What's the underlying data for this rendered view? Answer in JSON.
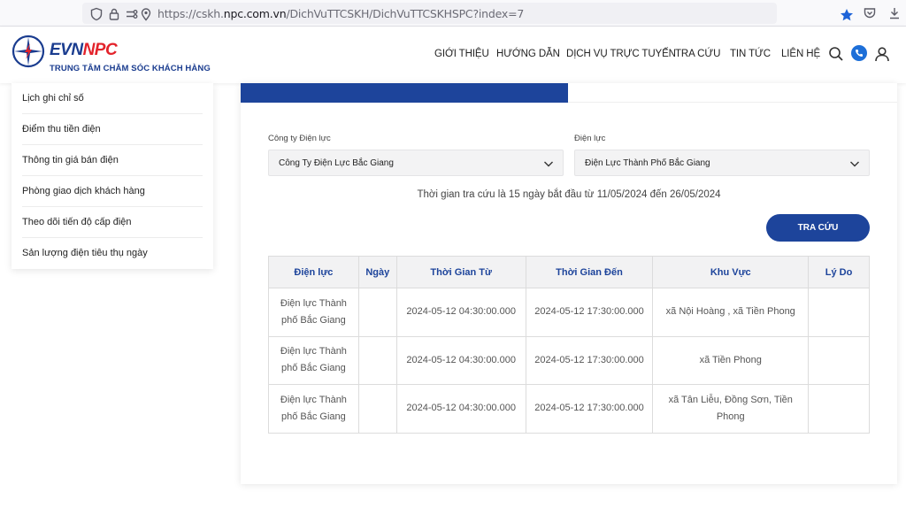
{
  "browser": {
    "url_prefix": "https://cskh.",
    "url_domain": "npc.com.vn",
    "url_path": "/DichVuTTCSKH/DichVuTTCSKHSPC?index=7"
  },
  "header": {
    "brand_evn": "EVN",
    "brand_npc": "NPC",
    "tagline": "TRUNG TÂM CHĂM SÓC KHÁCH HÀNG",
    "nav": [
      "GIỚI THIỆU",
      "HƯỚNG DẪN",
      "DỊCH VỤ TRỰC TUYẾN",
      "TRA CỨU",
      "TIN TỨC",
      "LIÊN HỆ"
    ]
  },
  "sidebar": {
    "items": [
      "Lịch ghi chỉ số",
      "Điểm thu tiền điện",
      "Thông tin giá bán điện",
      "Phòng giao dịch khách hàng",
      "Theo dõi tiến độ cấp điện",
      "Sản lượng điện tiêu thụ ngày"
    ]
  },
  "form": {
    "company_label": "Công ty Điện lực",
    "company_value": "Công Ty Điện Lực Bắc Giang",
    "branch_label": "Điện lực",
    "branch_value": "Điện Lực Thành Phố Bắc Giang",
    "info": "Thời gian tra cứu là 15 ngày bắt đầu từ 11/05/2024 đến 26/05/2024",
    "search_button": "TRA CỨU"
  },
  "table": {
    "headers": [
      "Điện lực",
      "Ngày",
      "Thời Gian Từ",
      "Thời Gian Đến",
      "Khu Vực",
      "Lý Do"
    ],
    "rows": [
      {
        "unit_line1": "Điện lực Thành",
        "unit_line2": "phố Bắc Giang",
        "date": "",
        "from": "2024-05-12 04:30:00.000",
        "to": "2024-05-12 17:30:00.000",
        "area": "xã Nội Hoàng , xã Tiền Phong",
        "reason": ""
      },
      {
        "unit_line1": "Điện lực Thành",
        "unit_line2": "phố Bắc Giang",
        "date": "",
        "from": "2024-05-12 04:30:00.000",
        "to": "2024-05-12 17:30:00.000",
        "area": "xã Tiền Phong",
        "reason": ""
      },
      {
        "unit_line1": "Điện lực Thành",
        "unit_line2": "phố Bắc Giang",
        "date": "",
        "from": "2024-05-12 04:30:00.000",
        "to": "2024-05-12 17:30:00.000",
        "area": "xã Tân Liễu, Đồng Sơn, Tiền Phong",
        "reason": ""
      }
    ]
  },
  "colors": {
    "primary": "#1d449b",
    "brand_red": "#e3232b",
    "star": "#1d63d8"
  }
}
